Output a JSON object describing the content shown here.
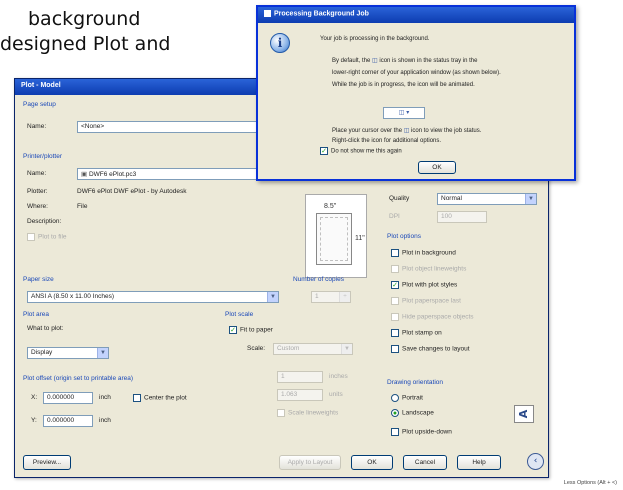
{
  "background_text": {
    "line1": "background",
    "line2": "designed Plot and"
  },
  "plot_dialog": {
    "title": "Plot - Model",
    "page_setup": {
      "group_label": "Page setup",
      "name_label": "Name:",
      "name_value": "<None>"
    },
    "printer": {
      "group_label": "Printer/plotter",
      "name_label": "Name:",
      "name_value": "DWF6 ePlot.pc3",
      "plotter_label": "Plotter:",
      "plotter_value": "DWF6 ePlot DWF ePlot - by Autodesk",
      "where_label": "Where:",
      "where_value": "File",
      "description_label": "Description:",
      "plot_to_file": "Plot to file",
      "dim_width": "8.5\"",
      "dim_height": "11\""
    },
    "paper_size": {
      "group_label": "Paper size",
      "value": "ANSI A (8.50 x 11.00 Inches)"
    },
    "copies": {
      "label": "Number of copies",
      "value": "1"
    },
    "plot_area": {
      "group_label": "Plot area",
      "what_label": "What to plot:",
      "what_value": "Display"
    },
    "plot_offset": {
      "group_label": "Plot offset (origin set to printable area)",
      "x_label": "X:",
      "x_value": "0.000000",
      "x_unit": "inch",
      "y_label": "Y:",
      "y_value": "0.000000",
      "y_unit": "inch",
      "center_label": "Center the plot"
    },
    "plot_scale": {
      "group_label": "Plot scale",
      "fit_label": "Fit to paper",
      "scale_label": "Scale:",
      "scale_value": "Custom",
      "v1": "1",
      "u1": "inches",
      "v2": "1.063",
      "u2": "units",
      "lineweights_label": "Scale lineweights"
    },
    "quality": {
      "label": "Quality",
      "value": "Normal",
      "dpi_label": "DPI",
      "dpi_value": "100"
    },
    "plot_options": {
      "group_label": "Plot options",
      "items": [
        {
          "label": "Plot in background",
          "checked": false,
          "enabled": true
        },
        {
          "label": "Plot object lineweights",
          "checked": false,
          "enabled": false
        },
        {
          "label": "Plot with plot styles",
          "checked": true,
          "enabled": true
        },
        {
          "label": "Plot paperspace last",
          "checked": false,
          "enabled": false
        },
        {
          "label": "Hide paperspace objects",
          "checked": false,
          "enabled": false
        },
        {
          "label": "Plot stamp on",
          "checked": false,
          "enabled": true
        },
        {
          "label": "Save changes to layout",
          "checked": false,
          "enabled": true
        }
      ]
    },
    "orientation": {
      "group_label": "Drawing orientation",
      "portrait": "Portrait",
      "landscape": "Landscape",
      "upside_down": "Plot upside-down",
      "icon": "A"
    },
    "buttons": {
      "preview": "Preview...",
      "apply": "Apply to Layout",
      "ok": "OK",
      "cancel": "Cancel",
      "help": "Help"
    }
  },
  "popup": {
    "title": "Processing Background Job",
    "line1": "Your job is processing in the background.",
    "line2a": "By default, the",
    "line2b": "icon is shown in the status tray in the",
    "line3": "lower-right corner of your application window (as shown below).",
    "line4": "While the job is in progress, the icon will be animated.",
    "line5a": "Place your cursor over the",
    "line5b": "icon to view the job status.",
    "line6": "Right-click the icon for additional options.",
    "dont_show": "Do not show me this again",
    "ok": "OK"
  },
  "footer": "Less Options (Alt + <)"
}
